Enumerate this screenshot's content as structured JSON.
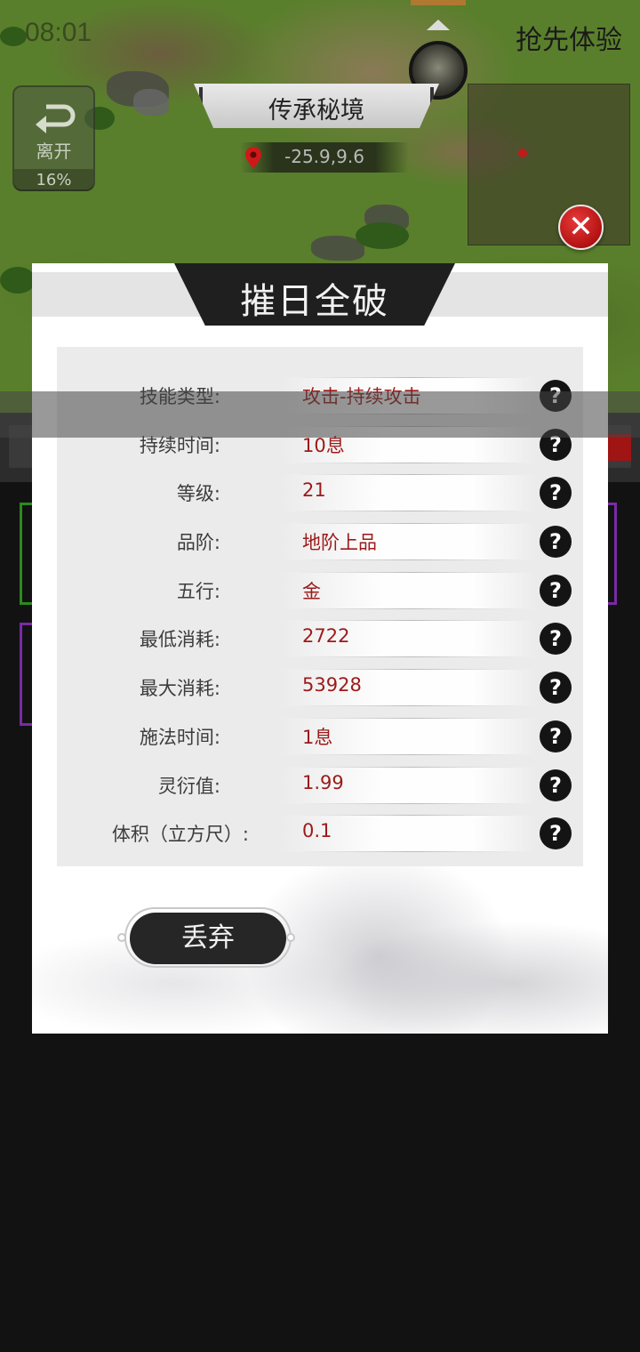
{
  "status": {
    "clock": "08:01",
    "early_access": "抢先体验"
  },
  "hud": {
    "leave_label": "离开",
    "leave_progress": "16%",
    "location_name": "传承秘境",
    "coordinates": "-25.9,9.6",
    "close_symbol": "✕"
  },
  "popup": {
    "title": "摧日全破",
    "help_symbol": "?",
    "stats": [
      {
        "label": "技能类型:",
        "value": "攻击-持续攻击"
      },
      {
        "label": "持续时间:",
        "value": "10息"
      },
      {
        "label": "等级:",
        "value": "21"
      },
      {
        "label": "品阶:",
        "value": "地阶上品"
      },
      {
        "label": "五行:",
        "value": "金"
      },
      {
        "label": "最低消耗:",
        "value": "2722"
      },
      {
        "label": "最大消耗:",
        "value": "53928"
      },
      {
        "label": "施法时间:",
        "value": "1息"
      },
      {
        "label": "灵衍值:",
        "value": "1.99"
      },
      {
        "label": "体积（立方尺）:",
        "value": "0.1"
      }
    ],
    "discard_label": "丢弃"
  },
  "colors": {
    "value_text": "#9c1a1a",
    "close_red": "#b31212",
    "accent_green": "#2a8a1e",
    "accent_purple": "#7a2aa6"
  }
}
